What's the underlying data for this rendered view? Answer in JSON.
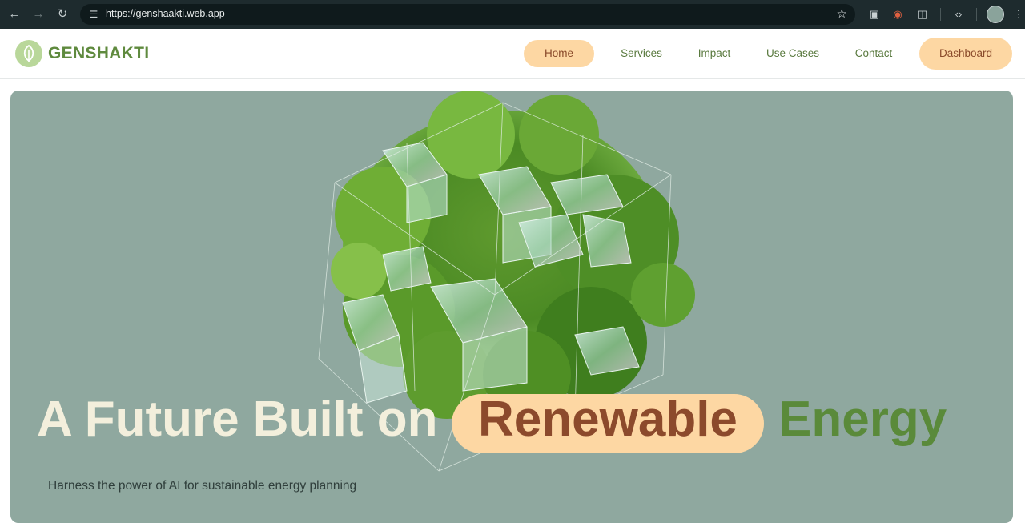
{
  "browser": {
    "url": "https://genshaakti.web.app",
    "back_icon": "arrow-left-icon",
    "forward_icon": "arrow-right-icon",
    "reload_icon": "reload-icon",
    "bookmark_icon": "star-icon"
  },
  "site": {
    "logo_text": "GENSHAKTI",
    "nav": {
      "home": "Home",
      "services": "Services",
      "impact": "Impact",
      "use_cases": "Use Cases",
      "contact": "Contact",
      "dashboard": "Dashboard"
    },
    "accent_color": "#fdd7a3",
    "brand_green": "#5f8a3e"
  },
  "hero": {
    "headline_part1": "A Future Built on",
    "headline_highlight": "Renewable",
    "headline_part3": "Energy",
    "subtitle": "Harness the power of AI for sustainable energy planning",
    "background_color": "#8fa89f"
  }
}
